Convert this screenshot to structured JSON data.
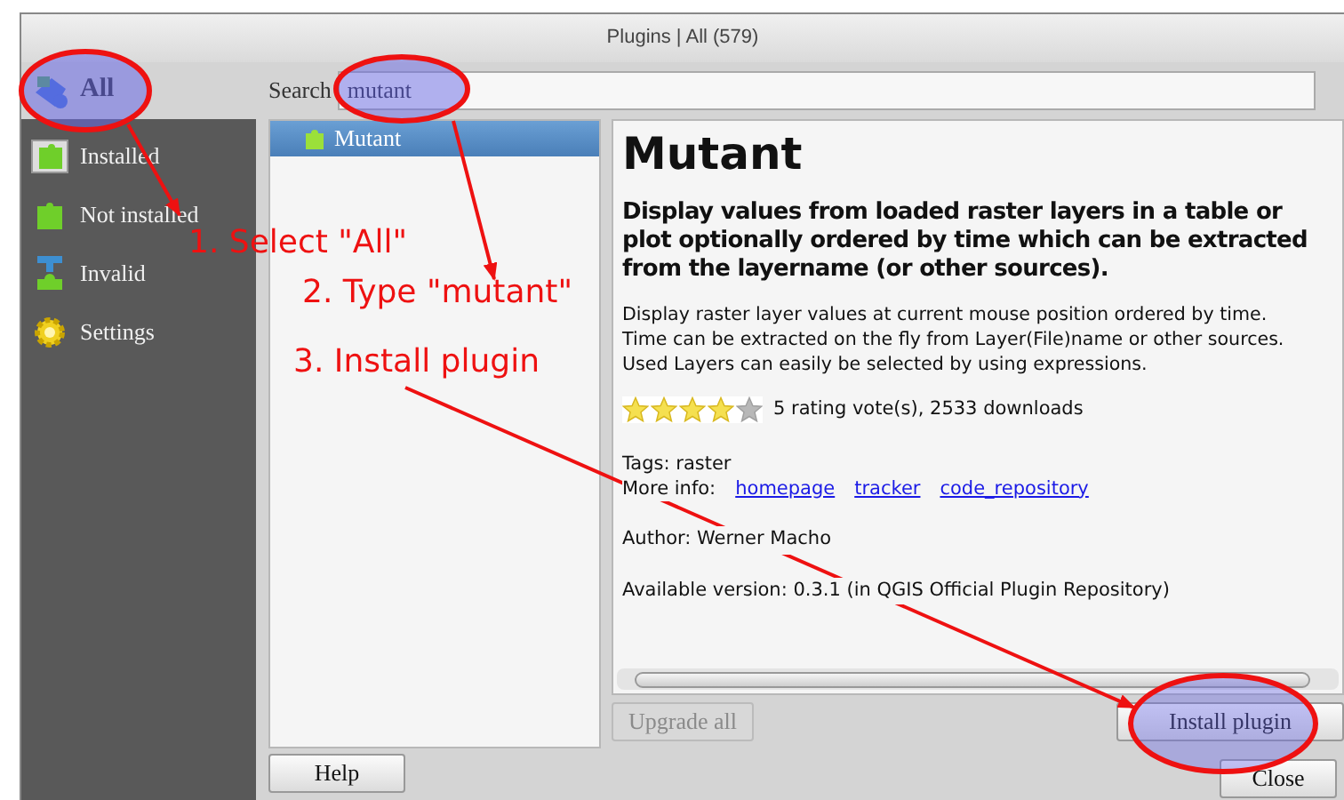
{
  "window": {
    "title": "Plugins | All (579)"
  },
  "sidebar": {
    "items": [
      {
        "label": "All",
        "kind": "all",
        "selected": true
      },
      {
        "label": "Installed",
        "kind": "installed",
        "selected": false
      },
      {
        "label": "Not installed",
        "kind": "not_installed",
        "selected": false
      },
      {
        "label": "Invalid",
        "kind": "invalid",
        "selected": false
      },
      {
        "label": "Settings",
        "kind": "settings",
        "selected": false
      }
    ]
  },
  "search": {
    "label": "Search",
    "value": "mutant"
  },
  "plugin_list": [
    {
      "label": "Mutant",
      "selected": true
    }
  ],
  "details": {
    "title": "Mutant",
    "summary": "Display values from loaded raster layers in a table or plot optionally ordered by time which can be extracted from the layername (or other sources).",
    "description": [
      "Display raster layer values at current mouse position ordered by time.",
      "Time can be extracted on the fly from Layer(File)name or other sources.",
      "Used Layers can easily be selected by using expressions."
    ],
    "stars": 4,
    "rating": "5 rating vote(s), 2533 downloads",
    "tags": "Tags: raster",
    "more_info_label": "More info:",
    "links": [
      "homepage",
      "tracker",
      "code_repository"
    ],
    "author": "Author: Werner Macho",
    "version": "Available version: 0.3.1 (in QGIS Official Plugin Repository)"
  },
  "buttons": {
    "upgrade_all": {
      "label": "Upgrade all",
      "disabled": true
    },
    "install": {
      "label": "Install plugin",
      "disabled": false
    },
    "help": {
      "label": "Help"
    },
    "close": {
      "label": "Close"
    }
  },
  "annotations": [
    "1. Select \"All\"",
    "2. Type \"mutant\"",
    "3. Install plugin"
  ]
}
